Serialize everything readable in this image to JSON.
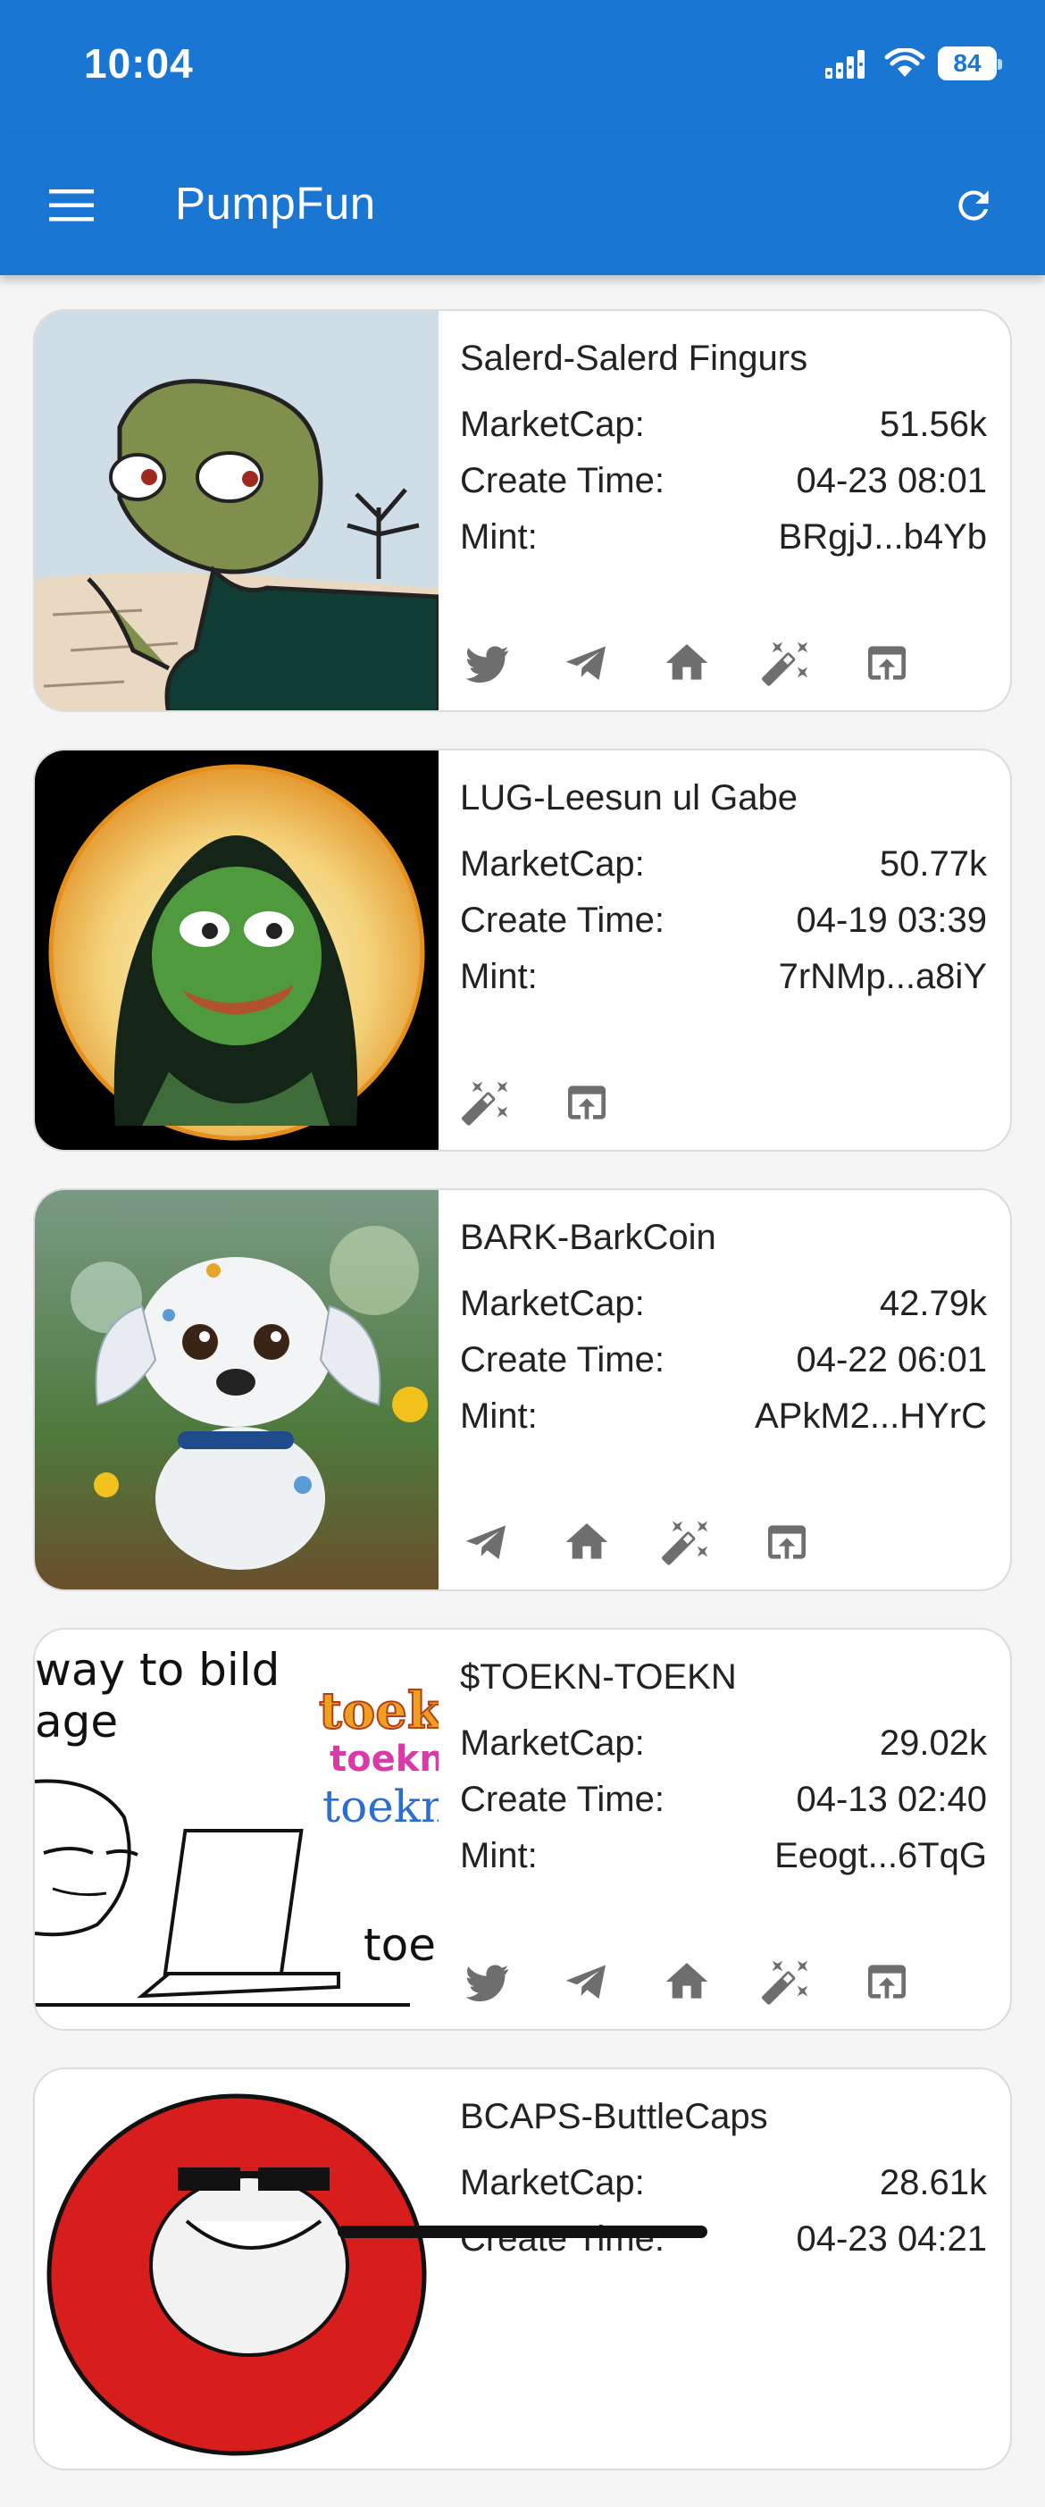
{
  "status_bar": {
    "time": "10:04",
    "battery": "84"
  },
  "app_bar": {
    "title": "PumpFun",
    "menu_icon": "menu-icon",
    "refresh_icon": "refresh-icon"
  },
  "labels": {
    "market_cap": "MarketCap:",
    "create_time": "Create Time:",
    "mint": "Mint:"
  },
  "tokens": [
    {
      "name": "Salerd-Salerd Fingurs",
      "market_cap": "51.56k",
      "create_time": "04-23 08:01",
      "mint": "BRgjJ...b4Yb",
      "links": [
        "twitter-icon",
        "telegram-icon",
        "home-icon",
        "magic-wand-icon",
        "open-in-icon"
      ]
    },
    {
      "name": "LUG-Leesun ul Gabe",
      "market_cap": "50.77k",
      "create_time": "04-19 03:39",
      "mint": "7rNMp...a8iY",
      "links": [
        "magic-wand-icon",
        "open-in-icon"
      ]
    },
    {
      "name": "BARK-BarkCoin",
      "market_cap": "42.79k",
      "create_time": "04-22 06:01",
      "mint": "APkM2...HYrC",
      "links": [
        "telegram-icon",
        "home-icon",
        "magic-wand-icon",
        "open-in-icon"
      ]
    },
    {
      "name": "$TOEKN-TOEKN",
      "market_cap": "29.02k",
      "create_time": "04-13 02:40",
      "mint": "Eeogt...6TqG",
      "links": [
        "twitter-icon",
        "telegram-icon",
        "home-icon",
        "magic-wand-icon",
        "open-in-icon"
      ],
      "image_text": {
        "line1": "way to bild",
        "line2": "age",
        "t1": "toekn",
        "t2": "toekn",
        "t3": "toekn",
        "t4": "toe"
      }
    },
    {
      "name": "BCAPS-ButtleCaps",
      "market_cap": "28.61k",
      "create_time": "04-23 04:21",
      "mint": "",
      "links": []
    }
  ]
}
